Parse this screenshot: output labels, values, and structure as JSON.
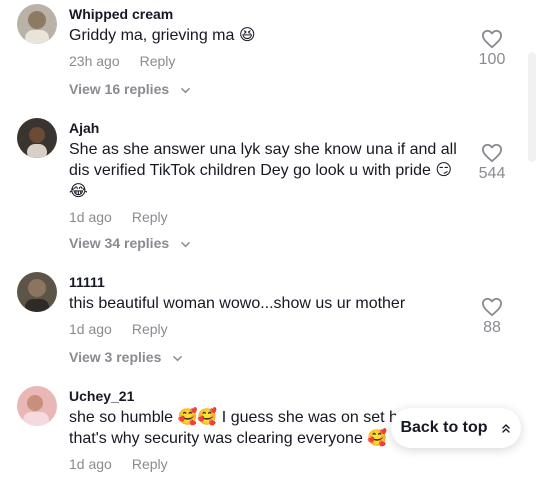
{
  "comments": [
    {
      "username": "Whipped cream",
      "text": "Griddy ma, grieving ma 😆",
      "time": "23h ago",
      "reply_label": "Reply",
      "likes": "100",
      "view_replies": "View 16 replies"
    },
    {
      "username": "Ajah",
      "text": "She as she answer una lyk say she know una if and all dis verified TikTok children Dey go look u with pride 😏😂",
      "time": "1d ago",
      "reply_label": "Reply",
      "likes": "544",
      "view_replies": "View 34 replies"
    },
    {
      "username": "11111",
      "text": "this beautiful woman wowo...show us ur mother",
      "time": "1d ago",
      "reply_label": "Reply",
      "likes": "88",
      "view_replies": "View 3 replies"
    },
    {
      "username": "Uchey_21",
      "text": "she so humble 🥰🥰 I guess she was on set h",
      "text_line2": "that's why security was clearing everyone 🥰",
      "time": "1d ago",
      "reply_label": "Reply"
    }
  ],
  "back_to_top": {
    "label": "Back to top"
  },
  "icons": {
    "like": "heart-outline-icon",
    "expand": "chevron-down-icon",
    "back_to_top": "double-chevron-up-icon"
  },
  "colors": {
    "text": "#161823",
    "secondary": "#8a8b91",
    "background": "#ffffff"
  }
}
